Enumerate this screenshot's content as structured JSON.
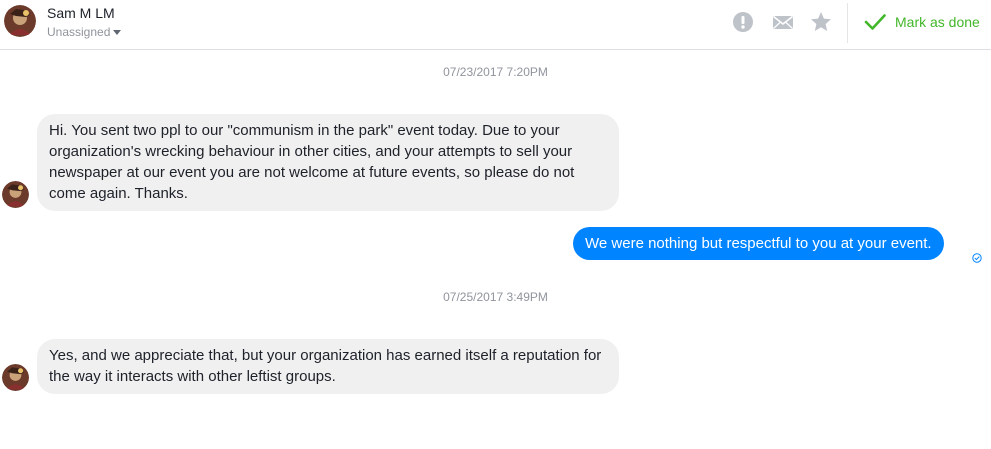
{
  "header": {
    "contact_name": "Sam M LM",
    "assignment": "Unassigned",
    "mark_done_label": "Mark as done",
    "icons": [
      "report-icon",
      "mail-icon",
      "star-icon",
      "checkmark-icon",
      "chevron-down-icon"
    ]
  },
  "thread": {
    "timestamp_1": "07/23/2017 7:20PM",
    "message_1": "Hi. You sent two ppl to our \"communism in the park\" event today. Due to your organization's wrecking behaviour in other cities, and your attempts to sell your newspaper at our event you are not welcome at future events, so please do not come again. Thanks.",
    "message_2": "We were nothing but respectful to you at your event.",
    "timestamp_2": "07/25/2017 3:49PM",
    "message_3": "Yes, and we appreciate that, but your organization has earned itself a reputation for the way it interacts with other leftist groups."
  },
  "colors": {
    "outgoing_bubble": "#0084ff",
    "incoming_bubble": "#f1f0f0",
    "done_green": "#42b72a",
    "icon_gray": "#bec2c9"
  }
}
